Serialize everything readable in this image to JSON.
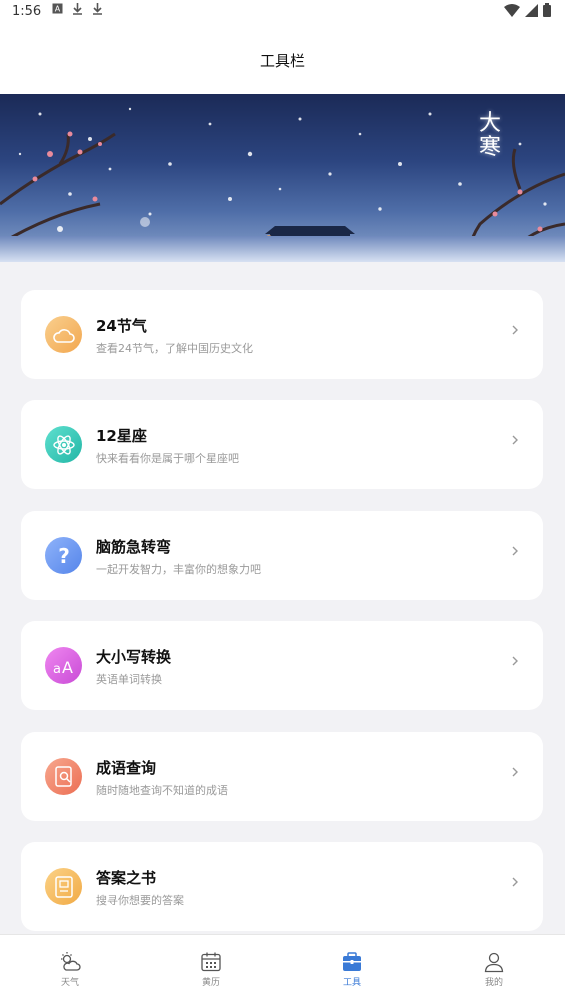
{
  "status_bar": {
    "time": "1:56",
    "left_icons": [
      "a-box-icon",
      "download-icon",
      "download-icon"
    ],
    "right_icons": [
      "wifi-icon",
      "signal-icon",
      "battery-icon"
    ]
  },
  "header": {
    "title": "工具栏"
  },
  "banner": {
    "title_line1": "大",
    "title_line2": "寒"
  },
  "tools": [
    {
      "title": "24节气",
      "desc": "查看24节气，了解中国历史文化",
      "icon": "cloud-icon",
      "color": "#f3b15e"
    },
    {
      "title": "12星座",
      "desc": "快来看看你是属于哪个星座吧",
      "icon": "atom-icon",
      "color": "#2fc7b5"
    },
    {
      "title": "脑筋急转弯",
      "desc": "一起开发智力，丰富你的想象力吧",
      "icon": "question-icon",
      "color": "#5f8ef0"
    },
    {
      "title": "大小写转换",
      "desc": "英语单词转换",
      "icon": "letter-case-icon",
      "color": "#d452d8"
    },
    {
      "title": "成语查询",
      "desc": "随时随地查询不知道的成语",
      "icon": "book-search-icon",
      "color": "#f07a5c"
    },
    {
      "title": "答案之书",
      "desc": "搜寻你想要的答案",
      "icon": "answer-book-icon",
      "color": "#f5b84e"
    }
  ],
  "bottom_nav": [
    {
      "label": "天气",
      "icon": "weather-icon"
    },
    {
      "label": "黄历",
      "icon": "calendar-icon"
    },
    {
      "label": "工具",
      "icon": "toolbox-icon",
      "active": true
    },
    {
      "label": "我的",
      "icon": "profile-icon"
    }
  ],
  "colors": {
    "accent": "#3a7ad6",
    "background": "#f2f2f5"
  }
}
